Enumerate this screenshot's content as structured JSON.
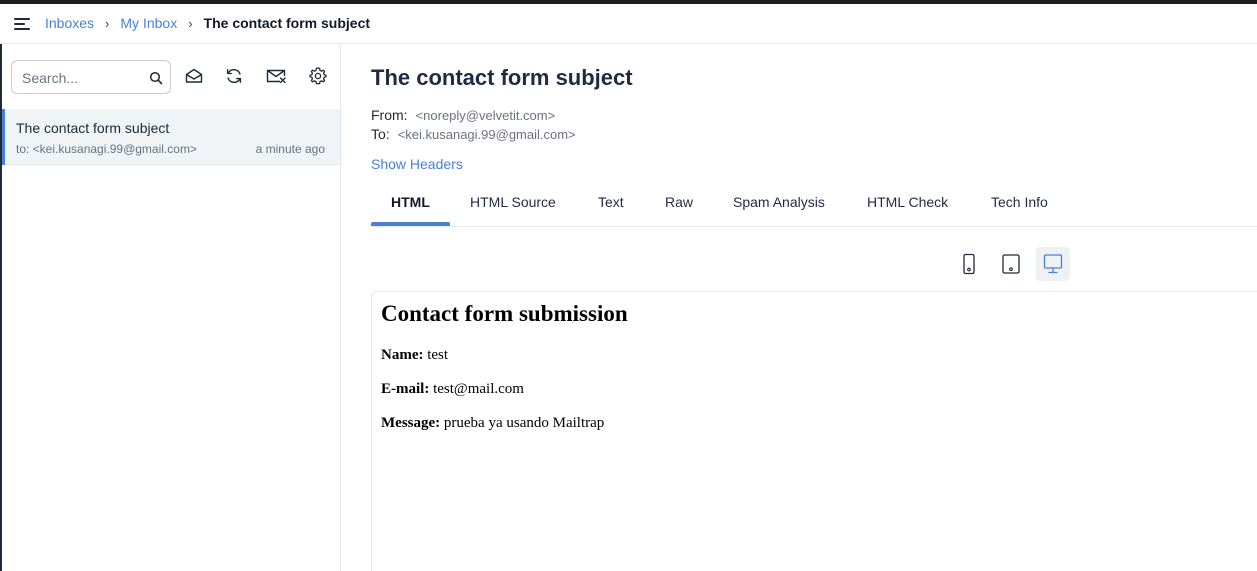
{
  "breadcrumb": {
    "inboxes": "Inboxes",
    "my_inbox": "My Inbox",
    "current": "The contact form subject",
    "separator": "›"
  },
  "sidebar": {
    "search_placeholder": "Search...",
    "toolbar_icons": [
      "envelope-open-icon",
      "refresh-icon",
      "clear-inbox-icon",
      "gear-icon"
    ],
    "messages": [
      {
        "subject": "The contact form subject",
        "to": "to: <kei.kusanagi.99@gmail.com>",
        "time": "a minute ago"
      }
    ]
  },
  "message": {
    "title": "The contact form subject",
    "from_label": "From:",
    "from_value": "<noreply@velvetit.com>",
    "to_label": "To:",
    "to_value": "<kei.kusanagi.99@gmail.com>",
    "show_headers": "Show Headers"
  },
  "tabs": [
    "HTML",
    "HTML Source",
    "Text",
    "Raw",
    "Spam Analysis",
    "HTML Check",
    "Tech Info"
  ],
  "active_tab": "HTML",
  "device_views": [
    "mobile-icon",
    "tablet-icon",
    "desktop-icon"
  ],
  "active_device": "desktop-icon",
  "email_body": {
    "heading": "Contact form submission",
    "name_label": "Name:",
    "name_value": "test",
    "email_label": "E-mail:",
    "email_value": "test@mail.com",
    "message_label": "Message:",
    "message_value": "prueba ya usando Mailtrap"
  },
  "colors": {
    "accent": "#4a7fd6",
    "selected_row": "#f1f4f6",
    "title": "#1f2a44"
  }
}
